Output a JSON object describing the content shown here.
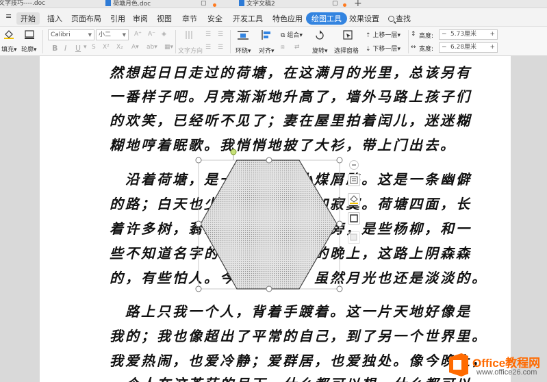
{
  "tabs": [
    {
      "title": "文字技巧----.doc",
      "active": false
    },
    {
      "title": "荷塘月色.doc",
      "active": false
    },
    {
      "title": "文字文稿2",
      "active": true
    }
  ],
  "menu": {
    "collapse": "≡",
    "items": [
      "开始",
      "插入",
      "页面布局",
      "引用",
      "审阅",
      "视图",
      "章节",
      "安全",
      "开发工具",
      "特色应用",
      "绘图工具",
      "效果设置"
    ],
    "active": "开始",
    "tool_tab": "绘图工具",
    "search": "查找"
  },
  "ribbon": {
    "fill": "填充",
    "outline": "轮廓",
    "font_name": "Calibri",
    "font_size": "小二",
    "bold": "B",
    "italic": "I",
    "underline": "U",
    "text_direction": "文字方向",
    "wrap": "环绕",
    "align": "对齐",
    "group": "组合",
    "rotate": "旋转",
    "select_pane": "选择窗格",
    "bring_forward": "上移一层",
    "send_backward": "下移一层",
    "height_label": "高度:",
    "height_value": "5.73厘米",
    "width_label": "宽度:",
    "width_value": "6.28厘米",
    "minus": "−",
    "plus": "+"
  },
  "document": {
    "lines": [
      "然想起日日走过的荷塘，在这满月的光里，总该另有",
      "一番样子吧。月亮渐渐地升高了，墙外马路上孩子们",
      "的欢笑，已经听不见了；妻在屋里拍着闰儿，迷迷糊",
      "糊地哼着眠歌。我悄悄地披了大衫，带上门出去。",
      "　沿着荷塘，是一条曲折的小煤屑路。这是一条幽僻",
      "的路；白天也少人走，夜晚更加寂寞。荷塘四面，长",
      "着许多树，蓊蓊郁郁的。路的一旁，是些杨柳，和一",
      "些不知道名字的树。没有月光的晚上，这路上阴森森",
      "的，有些怕人。今晚却很好，虽然月光也还是淡淡的。",
      "　路上只我一个人，背着手踱着。这一片天地好像是",
      "我的；我也像超出了平常的自己，到了另一个世界里。",
      "我爱热闹，也爱冷静；爱群居，也爱独处。像今晚上，",
      "一个人在这苍茫的月下，什么都可以想，什么都可以"
    ]
  },
  "shape": {
    "type": "hexagon",
    "fill": "#d8d8d8",
    "stroke": "#555555"
  },
  "watermark": {
    "brand": "Office教程网",
    "url": "www.office26.com",
    "color": "#ff6a00"
  }
}
